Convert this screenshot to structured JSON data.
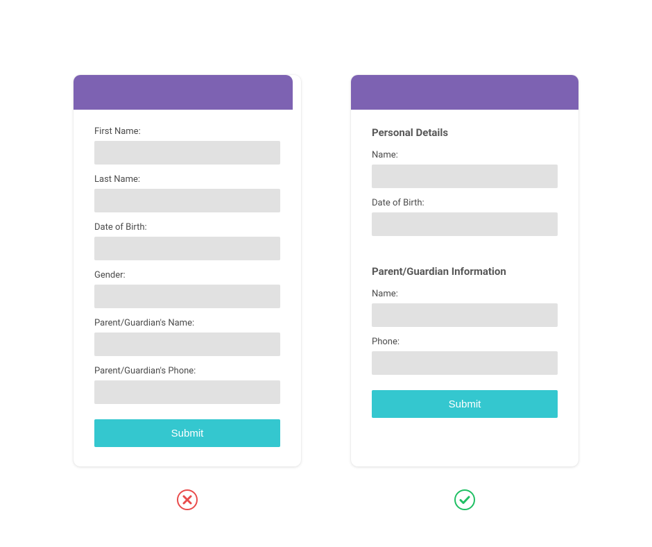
{
  "left_form": {
    "fields": [
      {
        "label": "First Name:"
      },
      {
        "label": "Last Name:"
      },
      {
        "label": "Date of Birth:"
      },
      {
        "label": "Gender:"
      },
      {
        "label": "Parent/Guardian's Name:"
      },
      {
        "label": "Parent/Guardian's Phone:"
      }
    ],
    "submit_label": "Submit"
  },
  "right_form": {
    "section1_title": "Personal Details",
    "section1_fields": [
      {
        "label": "Name:"
      },
      {
        "label": "Date of Birth:"
      }
    ],
    "section2_title": "Parent/Guardian Information",
    "section2_fields": [
      {
        "label": "Name:"
      },
      {
        "label": "Phone:"
      }
    ],
    "submit_label": "Submit"
  },
  "colors": {
    "header": "#7d62b2",
    "button": "#34c7cf",
    "input_bg": "#e1e1e1",
    "cross": "#e94b4b",
    "check": "#1fbf63"
  }
}
